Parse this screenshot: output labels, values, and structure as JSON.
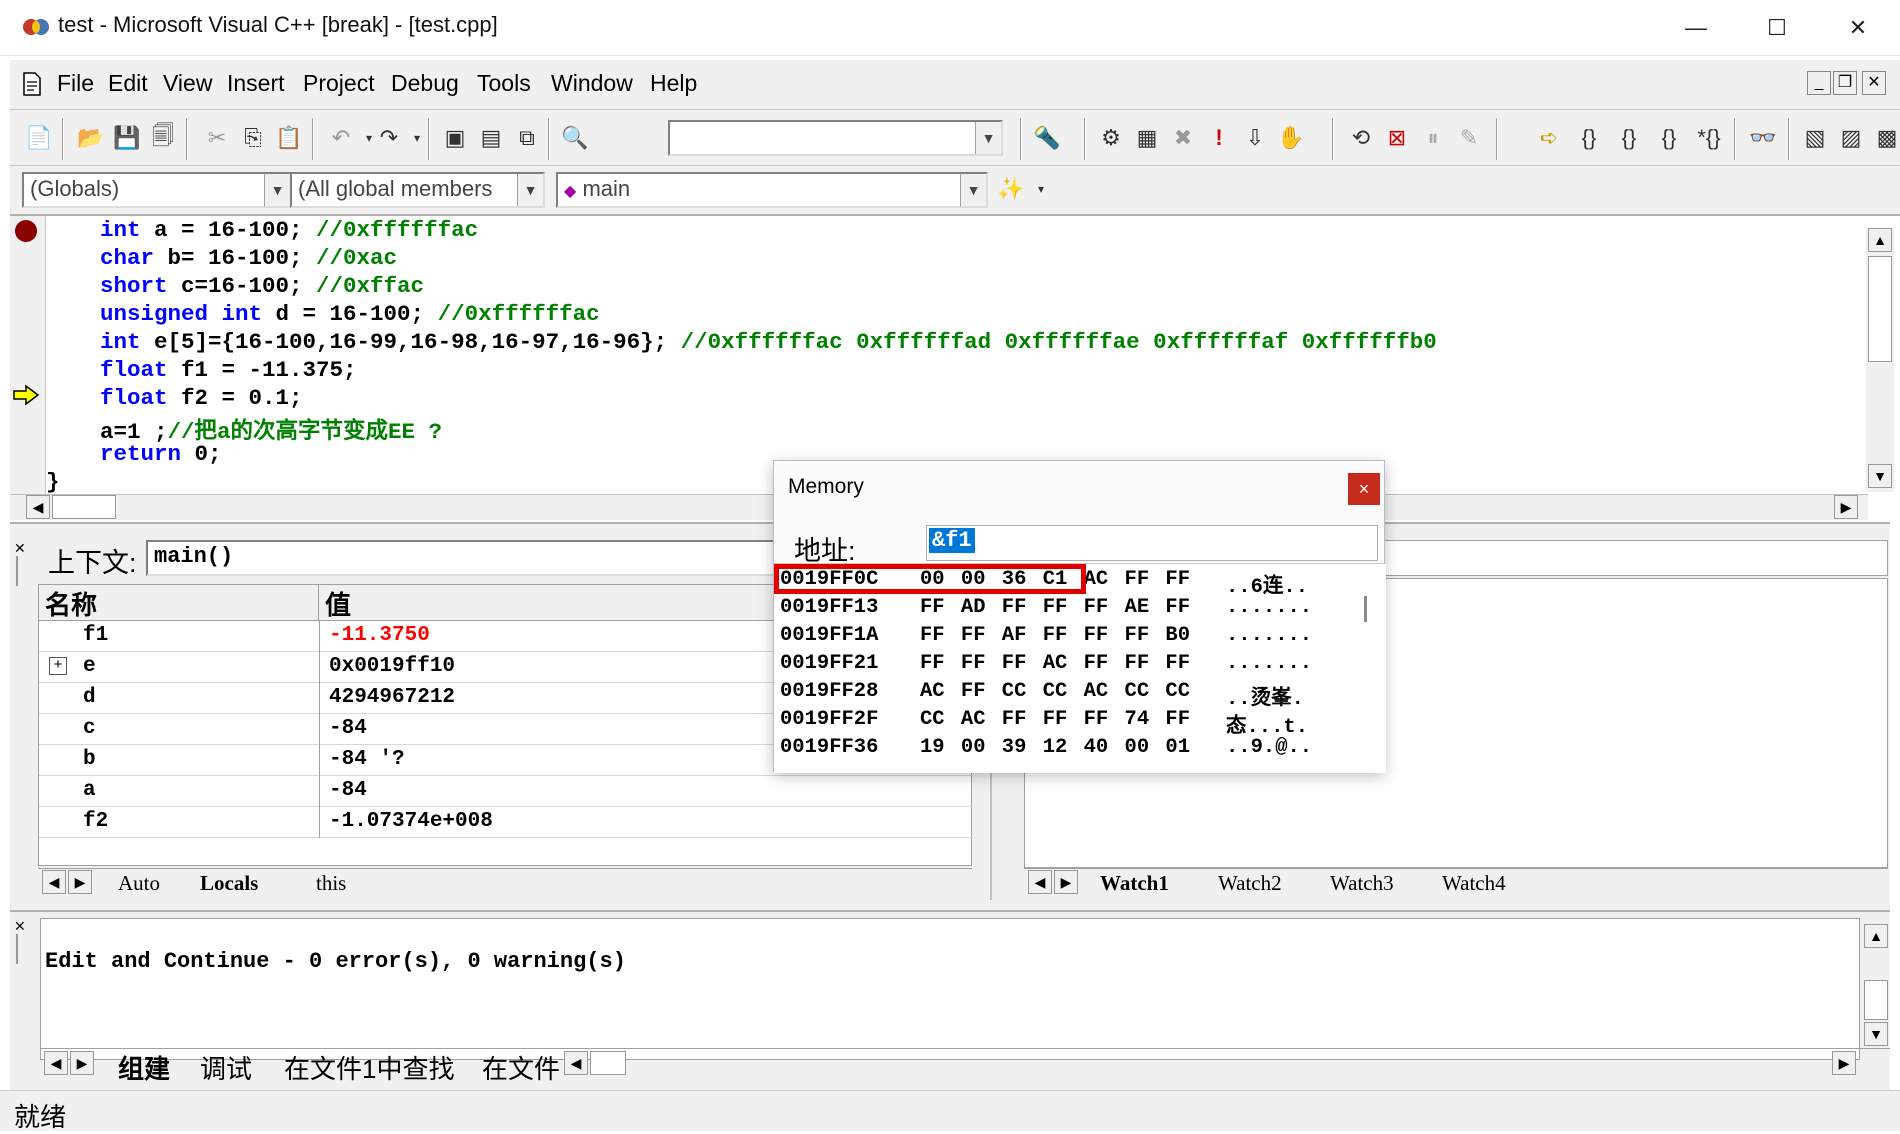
{
  "window": {
    "title": "test - Microsoft Visual C++ [break] - [test.cpp]",
    "minimize_glyph": "—",
    "maximize_glyph": "☐",
    "close_glyph": "✕"
  },
  "menu": {
    "items": [
      "File",
      "Edit",
      "View",
      "Insert",
      "Project",
      "Debug",
      "Tools",
      "Window",
      "Help"
    ],
    "mdi": [
      "_",
      "❐",
      "✕"
    ]
  },
  "toolbar": {
    "find_combo_value": ""
  },
  "wizardbar": {
    "class_combo": "(Globals)",
    "filter_combo": "(All global members",
    "member_combo": "main"
  },
  "editor": {
    "lines": [
      {
        "kw": "int",
        "rest": " a = 16-100; ",
        "comment": "//0xffffffac"
      },
      {
        "kw": "char",
        "rest": " b= 16-100; ",
        "comment": "//0xac"
      },
      {
        "kw": "short",
        "rest": " c=16-100; ",
        "comment": "//0xffac"
      },
      {
        "kw": "unsigned int",
        "rest": " d = 16-100; ",
        "comment": "//0xffffffac"
      },
      {
        "kw": "int",
        "rest": " e[5]={16-100,16-99,16-98,16-97,16-96}; ",
        "comment": "//0xffffffac 0xffffffad 0xffffffae 0xffffffaf 0xffffffb0"
      },
      {
        "kw": "float",
        "rest": " f1 = -11.375;",
        "comment": ""
      },
      {
        "kw": "float",
        "rest": " f2 = 0.1;",
        "comment": ""
      },
      {
        "kw": "",
        "rest": "a=1 ;",
        "comment": "//把a的次高字节变成EE ?"
      },
      {
        "kw": "return",
        "rest": " 0;",
        "comment": ""
      }
    ],
    "closing_brace": "}",
    "colors": {
      "keyword": "#0000ff",
      "comment": "#008000",
      "breakpoint": "#8b0000",
      "current_line_arrow": "#ffff00"
    }
  },
  "variables": {
    "context_label": "上下文:",
    "context_value": "main()",
    "col_name": "名称",
    "col_value": "值",
    "rows": [
      {
        "name": "f1",
        "value": "-11.3750",
        "changed": true,
        "expand": false
      },
      {
        "name": "e",
        "value": "0x0019ff10",
        "changed": false,
        "expand": true
      },
      {
        "name": "d",
        "value": "4294967212",
        "changed": false,
        "expand": false
      },
      {
        "name": "c",
        "value": "-84",
        "changed": false,
        "expand": false
      },
      {
        "name": "b",
        "value": "-84 '?",
        "changed": false,
        "expand": false
      },
      {
        "name": "a",
        "value": "-84",
        "changed": false,
        "expand": false
      },
      {
        "name": "f2",
        "value": "-1.07374e+008",
        "changed": false,
        "expand": false
      }
    ],
    "tabs": [
      "Auto",
      "Locals",
      "this"
    ],
    "active_tab": "Locals"
  },
  "watch": {
    "tabs": [
      "Watch1",
      "Watch2",
      "Watch3",
      "Watch4"
    ],
    "active_tab": "Watch1"
  },
  "memory": {
    "title": "Memory",
    "address_label": "地址:",
    "address_value": "&f1",
    "rows": [
      {
        "addr": "0019FF0C",
        "bytes": "00 00 36 C1 AC FF FF",
        "ascii": "..6连.."
      },
      {
        "addr": "0019FF13",
        "bytes": "FF AD FF FF FF AE FF",
        "ascii": "......."
      },
      {
        "addr": "0019FF1A",
        "bytes": "FF FF AF FF FF FF B0",
        "ascii": "......."
      },
      {
        "addr": "0019FF21",
        "bytes": "FF FF FF AC FF FF FF",
        "ascii": "......."
      },
      {
        "addr": "0019FF28",
        "bytes": "AC FF CC CC AC CC CC",
        "ascii": "..烫峯."
      },
      {
        "addr": "0019FF2F",
        "bytes": "CC AC FF FF FF 74 FF",
        "ascii": "态...t."
      },
      {
        "addr": "0019FF36",
        "bytes": "19 00 39 12 40 00 01",
        "ascii": "..9.@.."
      }
    ],
    "highlight_color": "#e00000"
  },
  "output": {
    "message": "Edit and Continue - 0 error(s), 0 warning(s)",
    "tabs": [
      "组建",
      "调试",
      "在文件1中查找",
      "在文件"
    ],
    "active_tab": "组建"
  },
  "status": {
    "text": "就绪"
  }
}
